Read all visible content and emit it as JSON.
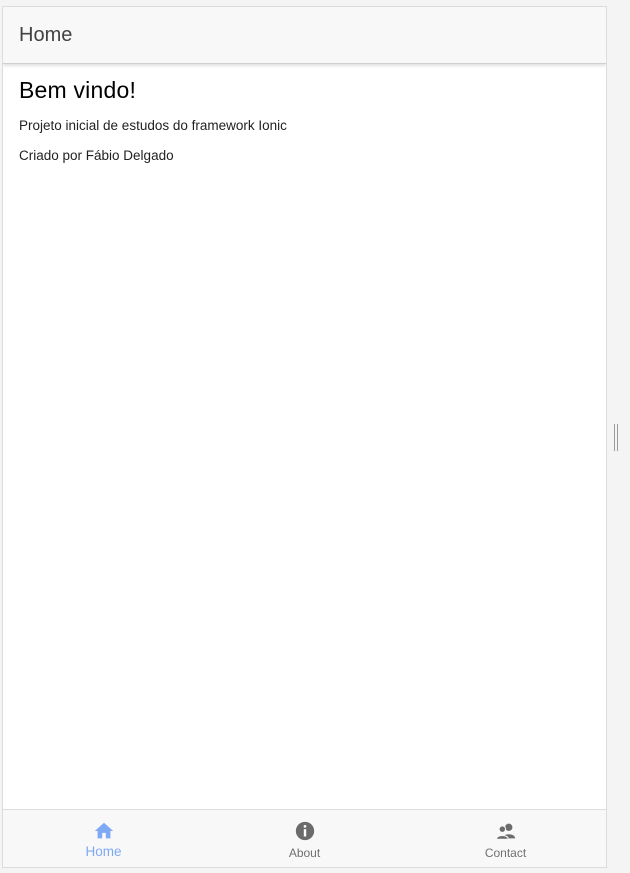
{
  "header": {
    "title": "Home"
  },
  "main": {
    "heading": "Bem vindo!",
    "paragraphs": [
      "Projeto inicial de estudos do framework Ionic",
      "Criado por Fábio Delgado"
    ]
  },
  "tabs": [
    {
      "label": "Home",
      "icon": "home-icon",
      "active": true
    },
    {
      "label": "About",
      "icon": "info-icon",
      "active": false
    },
    {
      "label": "Contact",
      "icon": "contacts-icon",
      "active": false
    }
  ],
  "colors": {
    "accent": "#7da9f5",
    "inactive_tab": "#707070",
    "toolbar_bg": "#f8f8f8"
  }
}
